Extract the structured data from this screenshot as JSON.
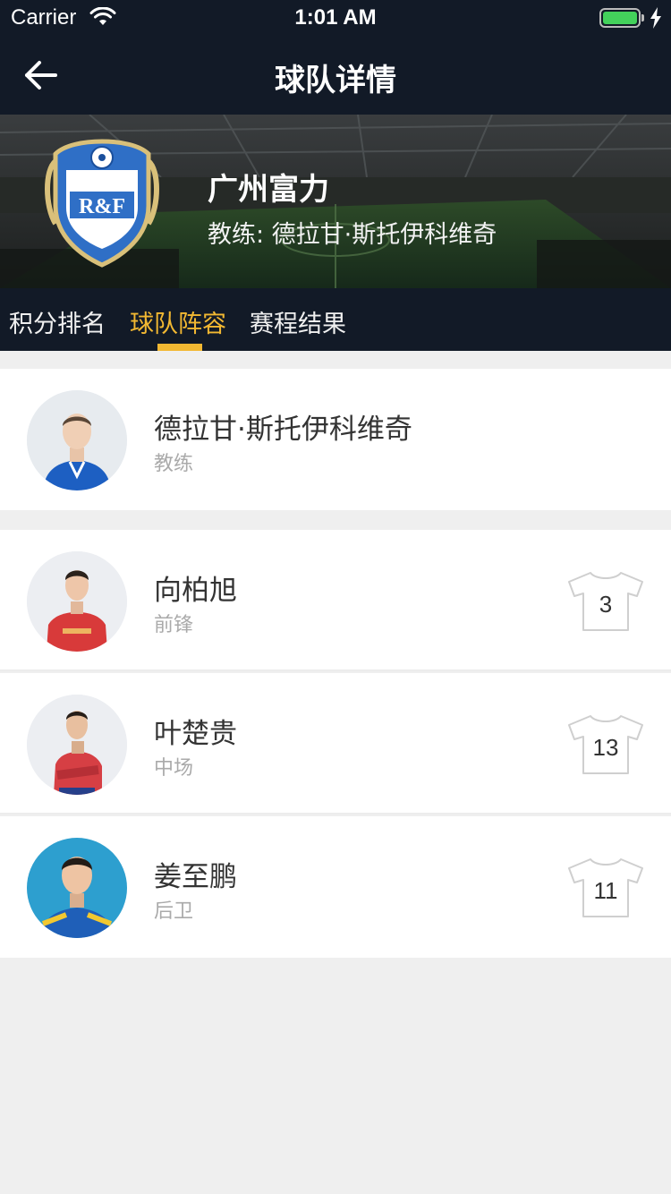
{
  "status_bar": {
    "carrier": "Carrier",
    "time": "1:01 AM",
    "battery_color": "#43d15b"
  },
  "nav": {
    "title": "球队详情",
    "back_icon": "arrow-left-icon"
  },
  "team": {
    "name": "广州富力",
    "coach": "教练: 德拉甘·斯托伊科维奇",
    "logo_text": "R&F"
  },
  "tabs": [
    {
      "label": "积分排名",
      "active": false
    },
    {
      "label": "球队阵容",
      "active": true
    },
    {
      "label": "赛程结果",
      "active": false
    }
  ],
  "accent_color": "#f2b832",
  "coach_card": {
    "name": "德拉甘·斯托伊科维奇",
    "role": "教练"
  },
  "players": [
    {
      "name": "向柏旭",
      "position": "前锋",
      "number": "3"
    },
    {
      "name": "叶楚贵",
      "position": "中场",
      "number": "13"
    },
    {
      "name": "姜至鹏",
      "position": "后卫",
      "number": "11"
    }
  ]
}
